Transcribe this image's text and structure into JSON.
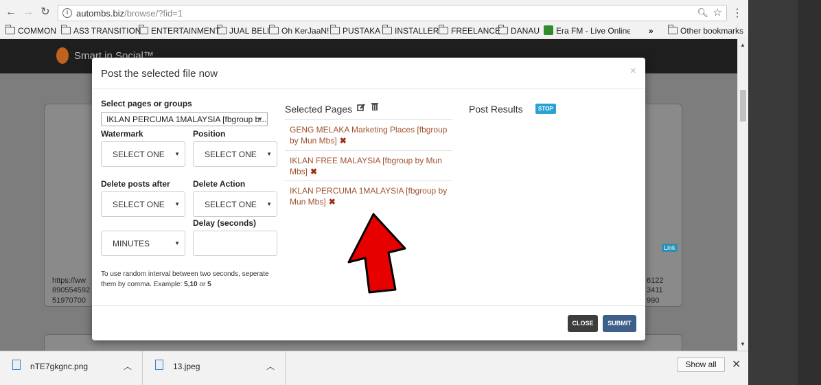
{
  "browser": {
    "url_host": "autombs.biz",
    "url_path": "/browse/?fid=1",
    "bookmarks": [
      {
        "label": "COMMON"
      },
      {
        "label": "AS3 TRANSITION"
      },
      {
        "label": "ENTERTAINMENT"
      },
      {
        "label": "JUAL BELI"
      },
      {
        "label": "Oh KerJaaN!"
      },
      {
        "label": "PUSTAKA"
      },
      {
        "label": "INSTALLER"
      },
      {
        "label": "FREELANCE"
      },
      {
        "label": "DANAU"
      }
    ],
    "radio_bookmark": "Era FM - Live Online R",
    "overflow_label": "»",
    "other_bookmarks": "Other bookmarks"
  },
  "app": {
    "brand": "Smart in Social™"
  },
  "background": {
    "left_text_1": "https://ww",
    "left_text_2": "890554592",
    "left_text_3": "51970700",
    "right_text_1": "6122",
    "right_text_2": "3411",
    "right_text_3": "990",
    "link_badge": "Link"
  },
  "modal": {
    "title": "Post the selected file now",
    "close_glyph": "×",
    "select_pages_label": "Select pages or groups",
    "select_pages_value": "IKLAN PERCUMA 1MALAYSIA [fbgroup b...",
    "watermark_label": "Watermark",
    "watermark_value": "SELECT ONE",
    "position_label": "Position",
    "position_value": "SELECT ONE",
    "delete_after_label": "Delete posts after",
    "delete_after_value": "SELECT ONE",
    "delete_action_label": "Delete Action",
    "delete_action_value": "SELECT ONE",
    "unit_value": "MINUTES",
    "delay_label": "Delay (seconds)",
    "hint_pre": "To use random interval between two seconds, seperate them by comma. Example: ",
    "hint_ex1": "5,10",
    "hint_or": " or ",
    "hint_ex2": "5",
    "selected_pages_title": "Selected Pages",
    "selected_pages": [
      {
        "name": "GENG MELAKA Marketing Places [fbgroup by Mun Mbs]"
      },
      {
        "name": "IKLAN FREE MALAYSIA [fbgroup by Mun Mbs]"
      },
      {
        "name": "IKLAN PERCUMA 1MALAYSIA [fbgroup by Mun Mbs]"
      }
    ],
    "remove_glyph": "✖",
    "post_results_title": "Post Results",
    "stop_label": "STOP",
    "close_button": "CLOSE",
    "submit_button": "SUBMIT"
  },
  "downloads": {
    "items": [
      {
        "name": "nTE7gkgnc.png"
      },
      {
        "name": "13.jpeg"
      }
    ],
    "show_all": "Show all"
  },
  "colors": {
    "arrow_fill": "#e60000",
    "selected_page_text": "#a0522d",
    "stop_bg": "#29a3d6",
    "submit_bg": "#3e5f8a",
    "close_bg": "#3d3d3d"
  }
}
